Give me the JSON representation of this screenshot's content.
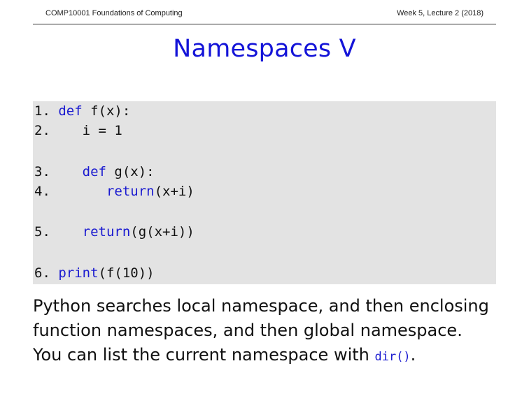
{
  "header": {
    "course": "COMP10001 Foundations of Computing",
    "week": "Week 5, Lecture 2 (2018)"
  },
  "title": "Namespaces V",
  "code": {
    "lines": [
      {
        "num": "1.",
        "indent": " ",
        "keyword": "def",
        "rest": " f(x):"
      },
      {
        "num": "2.",
        "indent": "    ",
        "keyword": "",
        "rest": "i = 1"
      },
      {
        "num": "3.",
        "indent": "    ",
        "keyword": "def",
        "rest": " g(x):"
      },
      {
        "num": "4.",
        "indent": "       ",
        "keyword": "return",
        "rest": "(x+i)"
      },
      {
        "num": "5.",
        "indent": "    ",
        "keyword": "return",
        "rest": "(g(x+i))"
      },
      {
        "num": "6.",
        "indent": " ",
        "keyword": "print",
        "rest": "(f(10))"
      }
    ]
  },
  "body": {
    "line1": "Python searches local namespace, and then enclosing",
    "line2": "function namespaces, and then global namespace.",
    "line3_pre": "You can list the current namespace with ",
    "line3_code": "dir()",
    "line3_post": "."
  }
}
